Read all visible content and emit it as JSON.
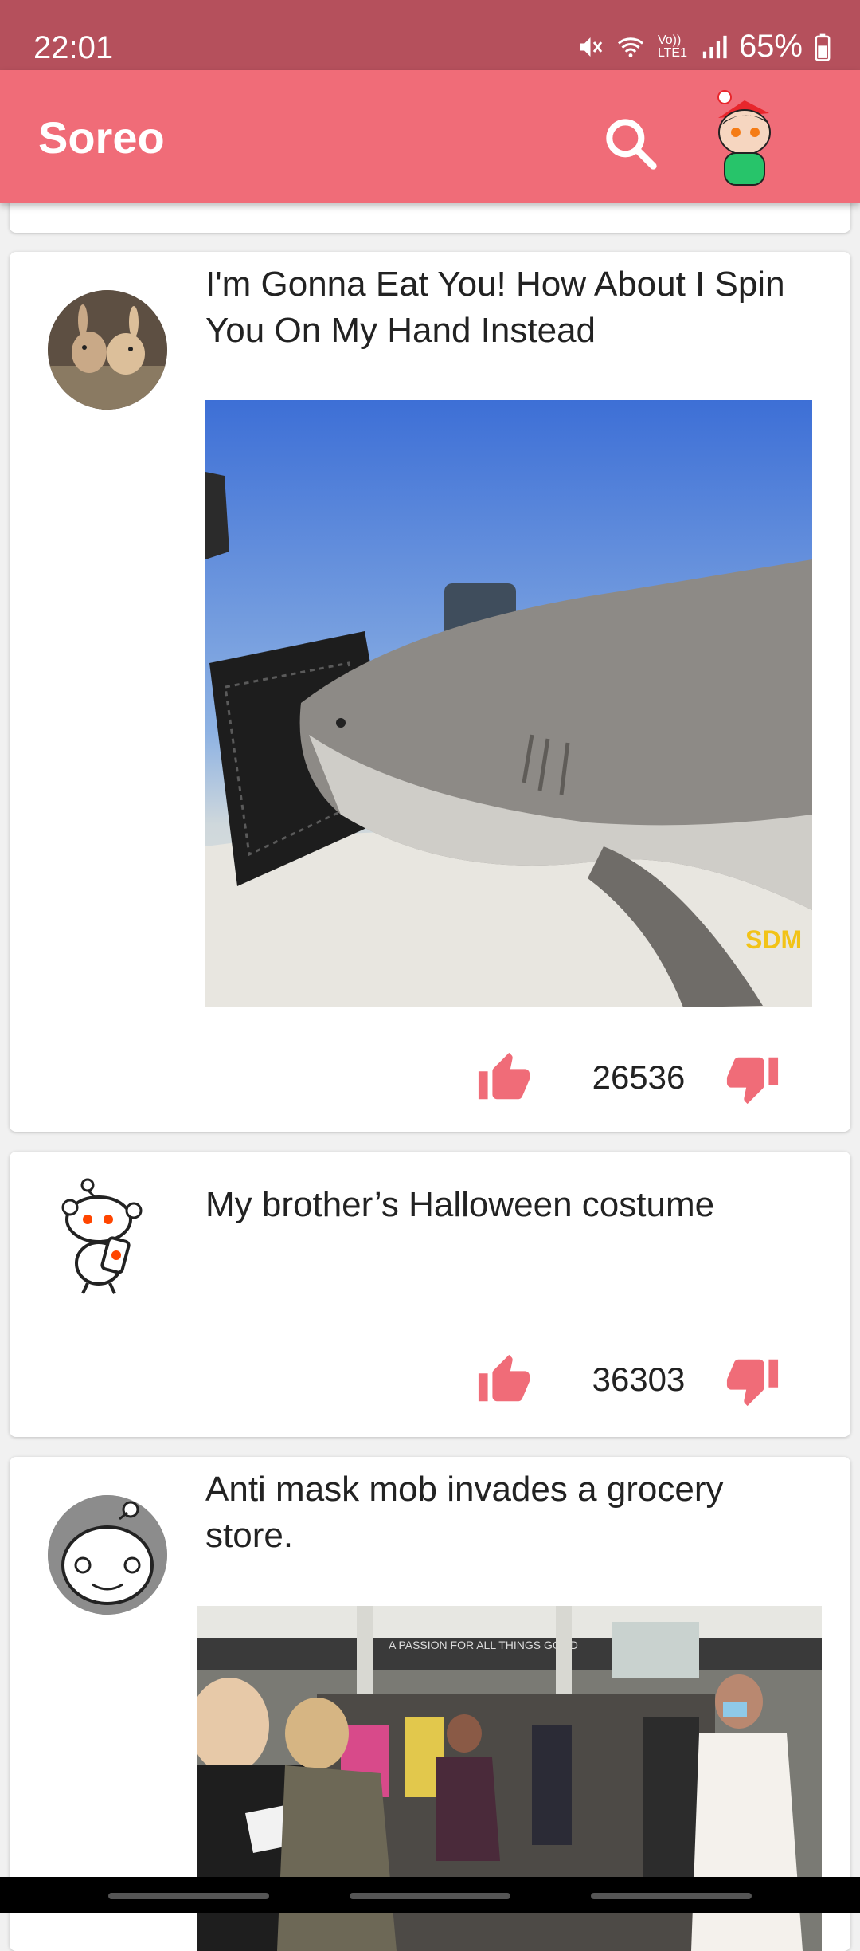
{
  "status_bar": {
    "time": "22:01",
    "network": "Vo)) LTE1",
    "battery": "65%"
  },
  "app_bar": {
    "title": "Soreo",
    "search_icon": "search-icon",
    "profile_icon": "reddit-avatar-icon"
  },
  "posts": [
    {
      "title": "I'm Gonna Eat You! How About I Spin You On My Hand Instead",
      "score": "26536",
      "media": "shark-video-thumbnail",
      "watermark": "SDM"
    },
    {
      "title": "My brother’s Halloween costume",
      "score": "36303",
      "media": null
    },
    {
      "title": "Anti mask mob invades a grocery store.",
      "media": "grocery-store-video-thumbnail",
      "store_banner": "A PASSION FOR ALL THINGS GOOD"
    }
  ],
  "colors": {
    "accent": "#f06c78",
    "status_bar": "#b5505c",
    "background": "#f1f1f1"
  }
}
